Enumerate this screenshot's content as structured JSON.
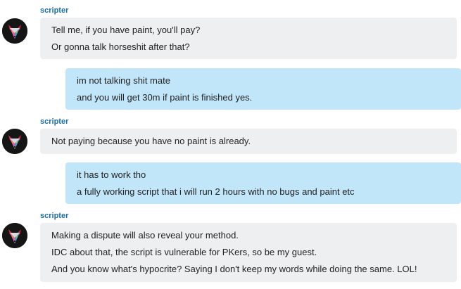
{
  "messages": [
    {
      "sender": "scripter",
      "lines": [
        "Tell me, if you have paint, you'll pay?",
        "Or gonna talk horseshit after that?"
      ]
    },
    {
      "sender": "",
      "lines": [
        "im not talking shit mate",
        "and you will get 30m if paint is finished yes."
      ]
    },
    {
      "sender": "scripter",
      "lines": [
        "Not paying because you have no paint is already."
      ]
    },
    {
      "sender": "",
      "lines": [
        "it has to work tho",
        "a fully working script that i will run 2 hours with no bugs and paint etc"
      ]
    },
    {
      "sender": "scripter",
      "lines": [
        "Making a dispute will also reveal your method.",
        "IDC about that, the script is vulnerable for PKers, so be my guest.",
        "And you know what's hypocrite? Saying I don't keep my words while doing the same. LOL!"
      ]
    }
  ],
  "colors": {
    "incoming_bubble": "#eeeff1",
    "outgoing_bubble": "#c2e6f9",
    "sender_name": "#1d6fa5",
    "text": "#222222"
  },
  "icons": {
    "avatar": "fox-avatar-icon"
  }
}
